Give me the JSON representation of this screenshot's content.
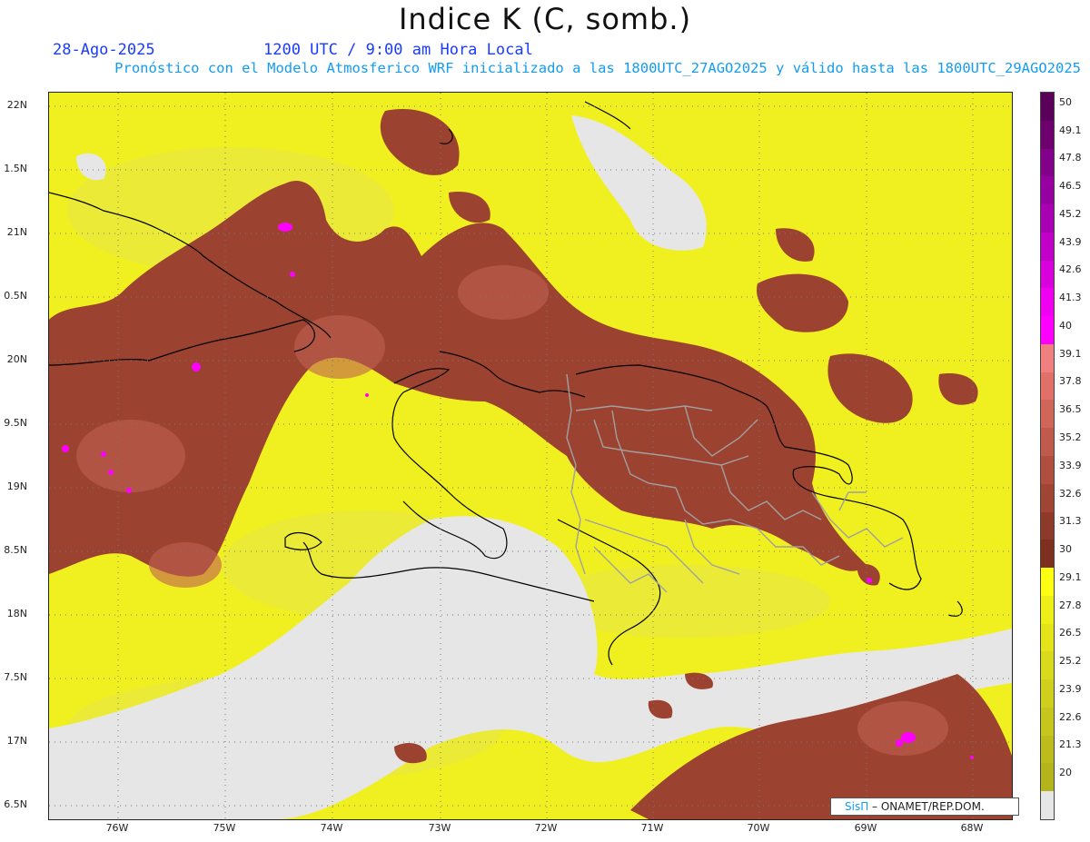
{
  "header": {
    "title": "Indice K (C, somb.)",
    "date": "28-Ago-2025",
    "time": "1200 UTC / 9:00 am Hora Local",
    "forecast": "Pronóstico con el Modelo Atmosferico WRF inicializado a las 1800UTC_27AGO2025 y válido hasta las  1800UTC_29AGO2025"
  },
  "map": {
    "lat_labels": [
      "22N",
      "1.5N",
      "21N",
      "0.5N",
      "20N",
      "9.5N",
      "19N",
      "8.5N",
      "18N",
      "7.5N",
      "17N",
      "6.5N"
    ],
    "lon_labels": [
      "76W",
      "75W",
      "74W",
      "73W",
      "72W",
      "71W",
      "70W",
      "69W",
      "68W"
    ],
    "colors": {
      "no_data": "#e6e6e6",
      "k_20_30": "#f0f020",
      "k_30_40": "#9c4230",
      "k_40_plus": "#ff00ff",
      "coast": "#000000",
      "provinces": "#a0a0a0"
    }
  },
  "colorbar": {
    "labels": [
      "50",
      "49.1",
      "47.8",
      "46.5",
      "45.2",
      "43.9",
      "42.6",
      "41.3",
      "40",
      "39.1",
      "37.8",
      "36.5",
      "35.2",
      "33.9",
      "32.6",
      "31.3",
      "30",
      "29.1",
      "27.8",
      "26.5",
      "25.2",
      "23.9",
      "22.6",
      "21.3",
      "20"
    ],
    "colors": [
      "#5a005a",
      "#6e006e",
      "#82008a",
      "#9600a0",
      "#aa00b4",
      "#c000c8",
      "#d800dc",
      "#f000f0",
      "#ff00ff",
      "#f08080",
      "#e07068",
      "#d06658",
      "#c05a4c",
      "#b04e40",
      "#a04434",
      "#8e3a2a",
      "#7e3020",
      "#ffff14",
      "#eeee18",
      "#e4e41a",
      "#dada1c",
      "#d0d01c",
      "#c6c61c",
      "#bcbc1c",
      "#b4b41c",
      "#e6e6e6"
    ]
  },
  "credit": {
    "brand": "SisΠ",
    "text": " – ONAMET/REP.DOM."
  }
}
